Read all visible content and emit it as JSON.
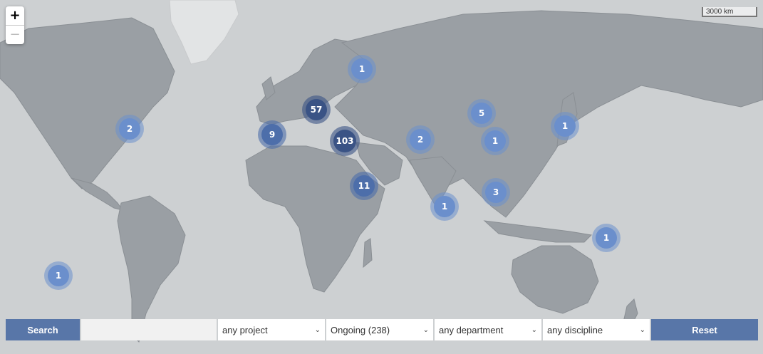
{
  "zoom": {
    "in_label": "+",
    "out_label": "−"
  },
  "scale_label": "3000 km",
  "clusters": [
    {
      "id": "russia",
      "count": "1",
      "tone": "light"
    },
    {
      "id": "europe",
      "count": "57",
      "tone": "dark"
    },
    {
      "id": "north-america",
      "count": "2",
      "tone": "light"
    },
    {
      "id": "iberia",
      "count": "9",
      "tone": "mid"
    },
    {
      "id": "middle-east",
      "count": "103",
      "tone": "dark"
    },
    {
      "id": "central-asia",
      "count": "2",
      "tone": "light"
    },
    {
      "id": "mongolia",
      "count": "5",
      "tone": "light"
    },
    {
      "id": "china",
      "count": "1",
      "tone": "light"
    },
    {
      "id": "japan",
      "count": "1",
      "tone": "light"
    },
    {
      "id": "east-africa",
      "count": "11",
      "tone": "mid"
    },
    {
      "id": "southeast-asia",
      "count": "3",
      "tone": "light"
    },
    {
      "id": "india-ocean",
      "count": "1",
      "tone": "light"
    },
    {
      "id": "melanesia",
      "count": "1",
      "tone": "light"
    },
    {
      "id": "pacific",
      "count": "1",
      "tone": "light"
    }
  ],
  "filters": {
    "search_label": "Search",
    "search_value": "",
    "project": "any project",
    "status": "Ongoing (238)",
    "department": "any department",
    "discipline": "any discipline",
    "reset_label": "Reset"
  },
  "colors": {
    "cluster_light": "#6b8fcc",
    "cluster_mid": "#4d6eaa",
    "cluster_dark": "#3a5385",
    "button": "#5876a8"
  }
}
